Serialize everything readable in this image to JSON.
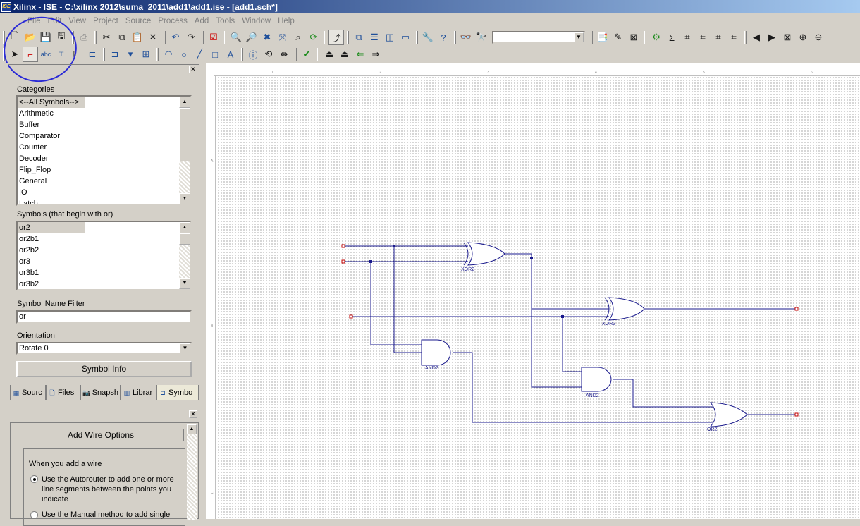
{
  "window": {
    "title": "Xilinx - ISE - C:\\xilinx 2012\\suma_2011\\add1\\add1.ise - [add1.sch*]",
    "app_icon": "ISE"
  },
  "menu": [
    "File",
    "Edit",
    "View",
    "Project",
    "Source",
    "Process",
    "Add",
    "Tools",
    "Window",
    "Help"
  ],
  "toolbar": {
    "search_value": ""
  },
  "symbols_panel": {
    "categories_label": "Categories",
    "categories": [
      "<--All Symbols-->",
      "Arithmetic",
      "Buffer",
      "Comparator",
      "Counter",
      "Decoder",
      "Flip_Flop",
      "General",
      "IO",
      "Latch"
    ],
    "symbols_label": "Symbols (that begin with or)",
    "symbols": [
      "or2",
      "or2b1",
      "or2b2",
      "or3",
      "or3b1",
      "or3b2"
    ],
    "filter_label": "Symbol Name Filter",
    "filter_value": "or",
    "orientation_label": "Orientation",
    "orientation_value": "Rotate 0",
    "symbol_info_button": "Symbol Info"
  },
  "panel_tabs": [
    "Sourc",
    "Files",
    "Snapsh",
    "Librar",
    "Symbo"
  ],
  "wire_options": {
    "title": "Add Wire Options",
    "prompt": "When you add a wire",
    "option_auto": "Use the Autorouter to add one or more line segments between the points you indicate",
    "option_manual": "Use the Manual method to add single"
  },
  "schematic": {
    "gates": [
      {
        "type": "XOR2",
        "label": "XOR2"
      },
      {
        "type": "XOR2",
        "label": "XOR2"
      },
      {
        "type": "AND2",
        "label": "AND2"
      },
      {
        "type": "AND2",
        "label": "AND2"
      },
      {
        "type": "OR2",
        "label": "OR2"
      }
    ],
    "ruler_top": [
      "1",
      "2",
      "3",
      "4",
      "5",
      "6"
    ],
    "ruler_left": [
      "A",
      "B",
      "C"
    ]
  },
  "colors": {
    "wire": "#1a1a8c",
    "gate": "#1a1a8c",
    "port": "#c00000",
    "annotation": "#2a2ad6"
  }
}
